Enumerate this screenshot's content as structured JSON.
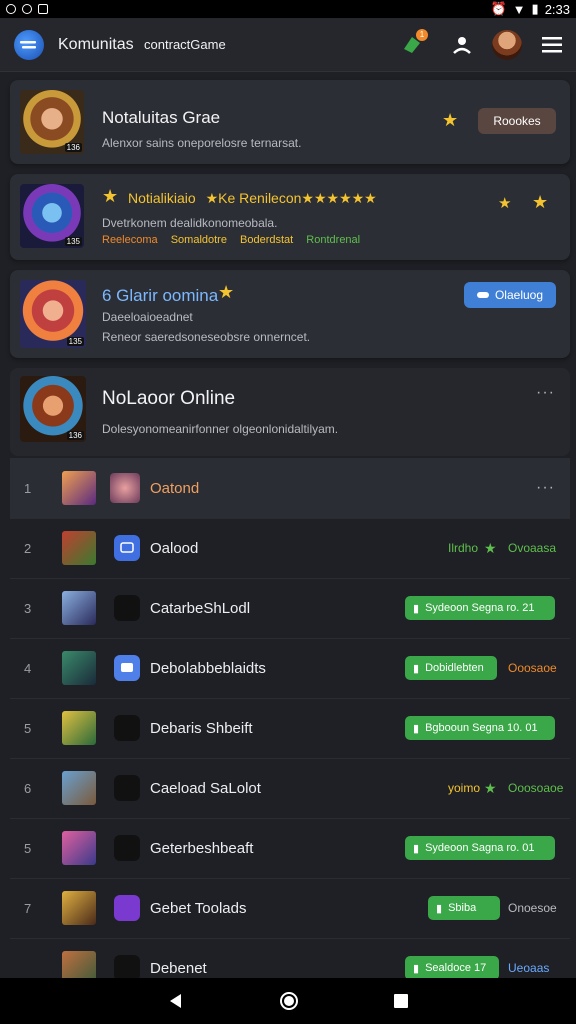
{
  "status": {
    "time": "2:33"
  },
  "appbar": {
    "title": "Komunitas",
    "subtitle": "contractGame",
    "notif_count": "1"
  },
  "featured": [
    {
      "title": "Notaluitas Grae",
      "subtitle": "Alenxor sains oneporelosre ternarsat.",
      "badge": "136",
      "button_label": "Roookes"
    },
    {
      "title": "Notialikiaio",
      "title_extra": "★Ke Renilecon★★★★★★",
      "line1": "Dvetrkonem dealidkonomeobala.",
      "tags": [
        "Reelecoma",
        "Somaldotre",
        "Boderdstat",
        "Rontdrenal"
      ],
      "badge": "135"
    },
    {
      "title": "6 Glarir oomina",
      "line1": "Daeeloaioeadnet",
      "line2": "Reneor saeredsoneseobsre onnerncet.",
      "badge": "135",
      "button_label": "Olaeluog"
    },
    {
      "title": "NoLaoor Online",
      "subtitle": "Dolesyonomeanirfonner olgeonlonidaltilyam.",
      "badge": "136"
    }
  ],
  "rows": [
    {
      "num": "1",
      "label": "Oatond",
      "label_color": "#f0a060"
    },
    {
      "num": "2",
      "label": "Oalood",
      "tag_left": "Ilrdho",
      "tag_right": "Ovoaasa"
    },
    {
      "num": "3",
      "label": "CatarbeShLodl",
      "button": "Sydeoon Segna ro. 21"
    },
    {
      "num": "4",
      "label": "Debolabbeblaidts",
      "button": "Dobidlebten",
      "tag_right": "Ooosaoe"
    },
    {
      "num": "5",
      "label": "Debaris Shbeift",
      "button": "Bgbooun Segna 10. 01"
    },
    {
      "num": "6",
      "label": "Caeload SaLolot",
      "tag_left": "yoimo",
      "tag_right": "Ooosoaoe"
    },
    {
      "num": "5",
      "label": "Geterbeshbeaft",
      "button": "Sydeoon Sagna ro. 01"
    },
    {
      "num": "7",
      "label": "Gebet Toolads",
      "button": "Sbiba",
      "tag_right": "Onoesoe"
    },
    {
      "num": "",
      "label": "Debenet",
      "button": "Sealdoce 17",
      "tag_right": "Ueoaas"
    }
  ]
}
